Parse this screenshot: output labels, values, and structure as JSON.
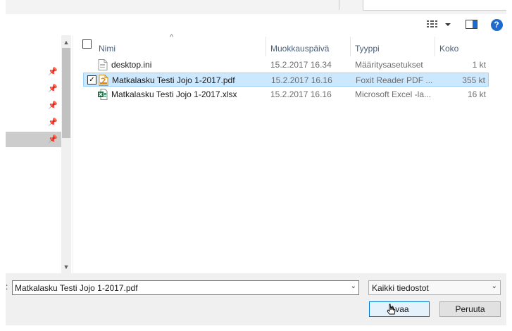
{
  "toolbar": {
    "view_icon": "details-view-icon",
    "preview_icon": "preview-pane-icon",
    "help_label": "?"
  },
  "file_list": {
    "columns": {
      "name": "Nimi",
      "modified": "Muokkauspäivä",
      "type": "Tyyppi",
      "size": "Koko"
    },
    "rows": [
      {
        "name": "desktop.ini",
        "modified": "15.2.2017 16.34",
        "type": "Määritysasetukset",
        "size": "1 kt",
        "icon": "settings-file-icon",
        "selected": false
      },
      {
        "name": "Matkalasku Testi Jojo 1-2017.pdf",
        "modified": "15.2.2017 16.16",
        "type": "Foxit Reader PDF ...",
        "size": "355 kt",
        "icon": "pdf-file-icon",
        "selected": true
      },
      {
        "name": "Matkalasku Testi Jojo 1-2017.xlsx",
        "modified": "15.2.2017 16.16",
        "type": "Microsoft Excel -la...",
        "size": "16 kt",
        "icon": "excel-file-icon",
        "selected": false
      }
    ]
  },
  "bottom": {
    "filename_label": ":",
    "filename_value": "Matkalasku Testi Jojo 1-2017.pdf",
    "filter_value": "Kaikki tiedostot",
    "open_label": "Avaa",
    "cancel_label": "Peruuta"
  },
  "colors": {
    "accent": "#0078d7",
    "selected_row": "#cce8ff",
    "help": "#1e6bd0"
  }
}
